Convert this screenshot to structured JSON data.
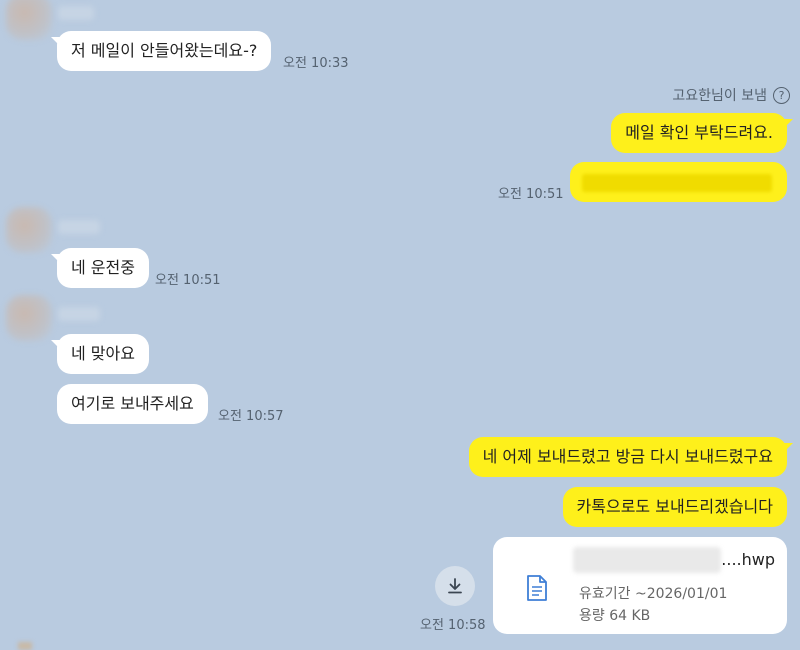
{
  "messages": [
    {
      "side": "left",
      "text": "저 메일이 안들어왔는데요-?",
      "time": "오전 10:33"
    },
    {
      "side": "right",
      "text": "메일 확인 부탁드려요."
    },
    {
      "side": "right",
      "text": "",
      "time": "오전 10:51"
    },
    {
      "side": "left",
      "text": "네 운전중",
      "time": "오전 10:51"
    },
    {
      "side": "left",
      "text": "네 맞아요"
    },
    {
      "side": "left",
      "text": "여기로 보내주세요",
      "time": "오전 10:57"
    },
    {
      "side": "right",
      "text": "네 어제 보내드렸고 방금 다시 보내드렸구요"
    },
    {
      "side": "right",
      "text": "카톡으로도 보내드리겠습니다"
    }
  ],
  "read_note": "고요한님이 보냄",
  "read_note_icon": "question-circle-icon",
  "file": {
    "name_suffix": "....hwp",
    "expiry": "유효기간 ~2026/01/01",
    "size": "용량 64 KB",
    "time": "오전 10:58",
    "icon": "document-icon",
    "download_icon": "download-icon"
  },
  "colors": {
    "background": "#b9cbe0",
    "my_bubble": "#fef01b",
    "their_bubble": "#ffffff"
  }
}
